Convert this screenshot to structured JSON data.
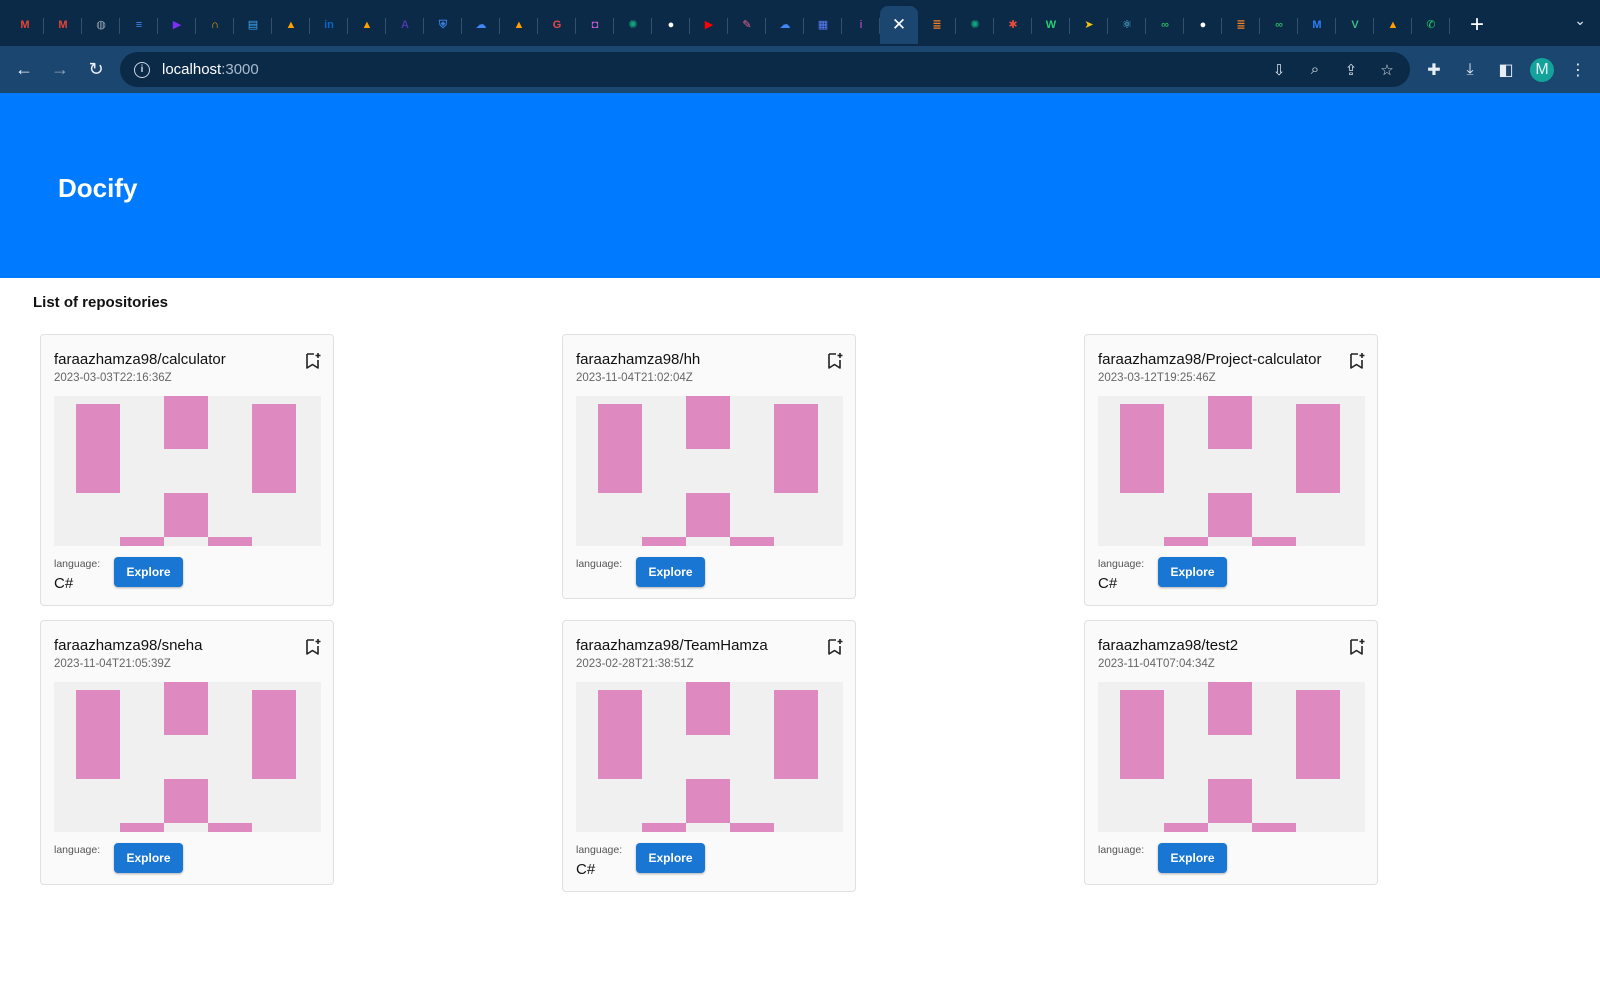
{
  "browser": {
    "tabs": [
      {
        "icon": "gmail-icon",
        "glyph": "M",
        "color": "#ea4335"
      },
      {
        "icon": "gmail-icon",
        "glyph": "M",
        "color": "#ea4335"
      },
      {
        "icon": "globe-icon",
        "glyph": "◍",
        "color": "#9aa7b5"
      },
      {
        "icon": "docs-icon",
        "glyph": "≡",
        "color": "#4285f4"
      },
      {
        "icon": "play-icon",
        "glyph": "▶",
        "color": "#7b2ff7"
      },
      {
        "icon": "headphones-icon",
        "glyph": "∩",
        "color": "#f4a300"
      },
      {
        "icon": "book-icon",
        "glyph": "▤",
        "color": "#3fa9f5"
      },
      {
        "icon": "firebase-icon",
        "glyph": "▲",
        "color": "#ffa000"
      },
      {
        "icon": "linkedin-icon",
        "glyph": "in",
        "color": "#0a66c2"
      },
      {
        "icon": "firebase-icon",
        "glyph": "▲",
        "color": "#ffa000"
      },
      {
        "icon": "a-icon",
        "glyph": "A",
        "color": "#4a3aa8"
      },
      {
        "icon": "shield-icon",
        "glyph": "⛨",
        "color": "#3b7ddd"
      },
      {
        "icon": "cloud-icon",
        "glyph": "☁",
        "color": "#4285f4"
      },
      {
        "icon": "firebase-icon",
        "glyph": "▲",
        "color": "#ffa000"
      },
      {
        "icon": "g-icon",
        "glyph": "G",
        "color": "#e5484d"
      },
      {
        "icon": "square-icon",
        "glyph": "◘",
        "color": "#c35bd1"
      },
      {
        "icon": "chatgpt-icon",
        "glyph": "✺",
        "color": "#10a37f"
      },
      {
        "icon": "github-icon",
        "glyph": "●",
        "color": "#ffffff"
      },
      {
        "icon": "youtube-icon",
        "glyph": "▶",
        "color": "#ff0000"
      },
      {
        "icon": "wand-icon",
        "glyph": "✎",
        "color": "#f06292"
      },
      {
        "icon": "cloud-icon",
        "glyph": "☁",
        "color": "#4285f4"
      },
      {
        "icon": "grid-icon",
        "glyph": "▦",
        "color": "#5c7cfa"
      },
      {
        "icon": "info-icon",
        "glyph": "i",
        "color": "#8e44ad"
      },
      {
        "icon": "close-icon",
        "glyph": "✕",
        "color": "#ffffff",
        "active": true
      },
      {
        "icon": "stack-icon",
        "glyph": "≣",
        "color": "#f48024"
      },
      {
        "icon": "chatgpt-icon",
        "glyph": "✺",
        "color": "#10a37f"
      },
      {
        "icon": "asterisk-icon",
        "glyph": "✱",
        "color": "#e74c3c"
      },
      {
        "icon": "w-icon",
        "glyph": "W",
        "color": "#2ecc71"
      },
      {
        "icon": "cursor-icon",
        "glyph": "➤",
        "color": "#f1c40f"
      },
      {
        "icon": "react-icon",
        "glyph": "⚛",
        "color": "#61dafb"
      },
      {
        "icon": "link-icon",
        "glyph": "∞",
        "color": "#27ae60"
      },
      {
        "icon": "github-icon",
        "glyph": "●",
        "color": "#ffffff"
      },
      {
        "icon": "stack-icon",
        "glyph": "≣",
        "color": "#f48024"
      },
      {
        "icon": "link-icon",
        "glyph": "∞",
        "color": "#27ae60"
      },
      {
        "icon": "m-icon",
        "glyph": "M",
        "color": "#2d7ff9"
      },
      {
        "icon": "vue-icon",
        "glyph": "V",
        "color": "#42b883"
      },
      {
        "icon": "firebase-icon",
        "glyph": "▲",
        "color": "#ffa000"
      },
      {
        "icon": "whatsapp-icon",
        "glyph": "✆",
        "color": "#25d366"
      }
    ],
    "url_host": "localhost",
    "url_port": ":3000",
    "avatar_letter": "M"
  },
  "page": {
    "title": "Docify",
    "section_title": "List of repositories",
    "explore_label": "Explore",
    "language_label": "language:",
    "repos": [
      {
        "name": "faraazhamza98/calculator",
        "date": "2023-03-03T22:16:36Z",
        "language": "C#"
      },
      {
        "name": "faraazhamza98/hh",
        "date": "2023-11-04T21:02:04Z",
        "language": ""
      },
      {
        "name": "faraazhamza98/Project-calculator",
        "date": "2023-03-12T19:25:46Z",
        "language": "C#"
      },
      {
        "name": "faraazhamza98/sneha",
        "date": "2023-11-04T21:05:39Z",
        "language": ""
      },
      {
        "name": "faraazhamza98/TeamHamza",
        "date": "2023-02-28T21:38:51Z",
        "language": "C#"
      },
      {
        "name": "faraazhamza98/test2",
        "date": "2023-11-04T07:04:34Z",
        "language": ""
      }
    ]
  },
  "colors": {
    "hero": "#007bff",
    "art_accent": "#de8ac1",
    "button": "#1976d2"
  }
}
